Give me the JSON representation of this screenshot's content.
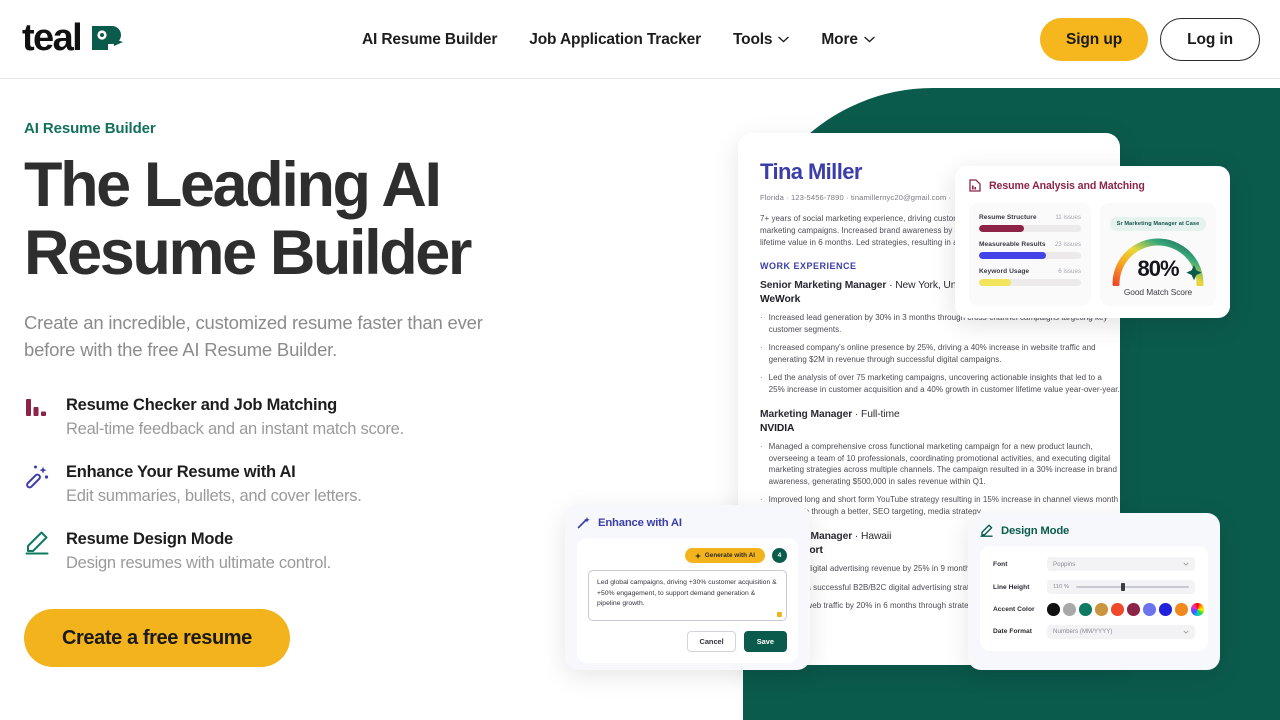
{
  "nav": {
    "logo_text": "teal",
    "logo_icon": "teal-bird-logo-icon",
    "links": [
      {
        "label": "AI Resume Builder",
        "has_caret": false
      },
      {
        "label": "Job Application Tracker",
        "has_caret": false
      },
      {
        "label": "Tools",
        "has_caret": true
      },
      {
        "label": "More",
        "has_caret": true
      }
    ],
    "signup_label": "Sign up",
    "login_label": "Log in"
  },
  "hero": {
    "eyebrow": "AI Resume Builder",
    "title_line1": "The Leading AI",
    "title_line2": "Resume Builder",
    "subtitle": "Create an incredible, customized resume faster than ever before with the free AI Resume Builder.",
    "cta_label": "Create a free resume",
    "features": [
      {
        "icon": "bar-chart-icon",
        "title": "Resume Checker and Job Matching",
        "desc": "Real-time feedback and an instant match score."
      },
      {
        "icon": "magic-wand-icon",
        "title": "Enhance Your Resume with AI",
        "desc": "Edit summaries, bullets, and cover letters."
      },
      {
        "icon": "pencil-icon",
        "title": "Resume Design Mode",
        "desc": "Design resumes with ultimate control."
      }
    ]
  },
  "resume": {
    "name": "Tina Miller",
    "contact": "Florida  ·  123-5456-7890  ·  tinamillernyc20@gmail.com  ·",
    "summary": "7+ years of social marketing experience, driving customer acquisition through B2B, and content marketing campaigns. Increased brand awareness by 40%, customer acquisition by 25%, customer lifetime value in 6 months. Led strategies, resulting in a 45% increase in revenue.",
    "section_title": "WORK EXPERIENCE",
    "jobs": [
      {
        "title": "Senior Marketing Manager",
        "meta": "New York, United",
        "company": "WeWork",
        "bullets": [
          "Increased lead generation by 30% in 3 months through cross-channel campaigns targeting key customer segments.",
          "Increased company's online presence by 25%, driving a 40% increase in website traffic and generating $2M in revenue through successful digital campaigns.",
          "Led the analysis of over 75 marketing campaigns, uncovering actionable insights that led to a 25% increase in customer acquisition and a 40% growth in customer lifetime value year-over-year."
        ]
      },
      {
        "title": "Marketing Manager",
        "meta": "Full-time",
        "company": "NVIDIA",
        "bullets": [
          "Managed a comprehensive cross functional marketing campaign for a new product launch, overseeing a team of 10 professionals, coordinating promotional activities, and executing digital marketing strategies across multiple channels. The campaign resulted in a 30% increase in brand awareness, generating $500,000 in sales revenue within Q1.",
          "Improved long and short form YouTube strategy resulting in 15% increase in channel views month over month through a better, SEO targeting, media strategy."
        ]
      },
      {
        "title": "Marketing Manager",
        "meta": "Hawaii",
        "company": "Sirius Resort",
        "bullets": [
          "Increased digital advertising revenue by 25% in 9 months through better budget management.",
          "Launched a successful B2B/B2C digital advertising strategy driving growth in 6 months.",
          "Increased web traffic by 20% in 6 months through strategic SEO."
        ]
      }
    ]
  },
  "analysis": {
    "icon": "resume-document-icon",
    "title": "Resume Analysis and Matching",
    "rows": [
      {
        "label": "Resume Structure",
        "issues": "11 issues",
        "fill_pct": 44,
        "color": "#8E2348"
      },
      {
        "label": "Measureable Results",
        "issues": "23 issues",
        "fill_pct": 66,
        "color": "#4343E8"
      },
      {
        "label": "Keyword Usage",
        "issues": "6 issues",
        "fill_pct": 31,
        "color": "#F2E55C"
      }
    ],
    "match_chip": "Sr Marketing Manager at Case",
    "match_score": "80%",
    "match_label": "Good Match Score",
    "gauge_fraction": 0.8
  },
  "enhance": {
    "icon": "magic-wand-icon",
    "title": "Enhance with AI",
    "generate_label": "Generate with AI",
    "generate_icon": "sparkle-wand-icon",
    "badge_count": "4",
    "textarea_value": "Led global campaigns, driving +30% customer acquisition & +50% engagement, to support demand generation & pipeline growth.",
    "cancel_label": "Cancel",
    "save_label": "Save"
  },
  "design": {
    "icon": "pencil-icon",
    "title": "Design Mode",
    "font_label": "Font",
    "font_value": "Poppins",
    "line_height_label": "Line Height",
    "line_height_value": "110 %",
    "accent_label": "Accent Color",
    "accent_swatches": [
      "#111111",
      "#A9A9A9",
      "#0F7A62",
      "#C9953F",
      "#F04A2C",
      "#8E2348",
      "#6B74EE",
      "#2222DD",
      "#F08A1E",
      "rainbow"
    ],
    "date_label": "Date Format",
    "date_value": "Numbers (MM/YYYY)"
  },
  "colors": {
    "teal": "#0B5B4D",
    "yellow": "#F2B31D",
    "indigo": "#3B3EA8",
    "maroon": "#8E2348"
  }
}
